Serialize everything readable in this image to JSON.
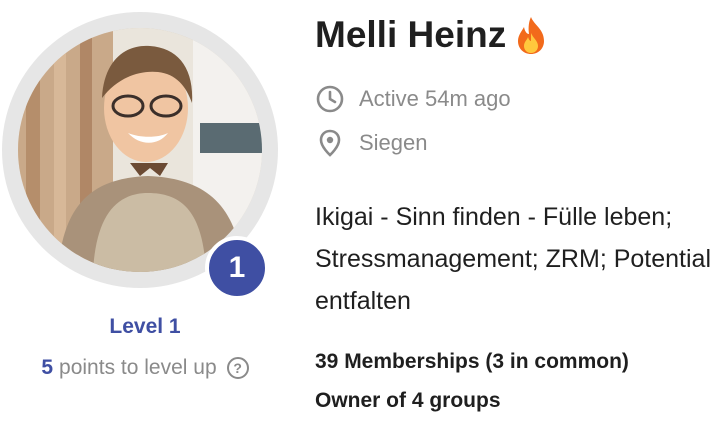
{
  "profile": {
    "name": "Melli Heinz",
    "status_icon": "fire-icon",
    "active": "Active 54m ago",
    "location": "Siegen",
    "bio": "Ikigai - Sinn finden - Fülle leben; Stressmanagement; ZRM; Potential entfalten"
  },
  "level": {
    "badge": "1",
    "label": "Level 1",
    "points": "5",
    "points_suffix": "points to level up"
  },
  "stats": {
    "memberships": "39 Memberships (3 in common)",
    "groups": "Owner of 4 groups"
  },
  "colors": {
    "accent": "#3f4fa3",
    "muted": "#8a8a8a",
    "text": "#1f1f1f"
  }
}
